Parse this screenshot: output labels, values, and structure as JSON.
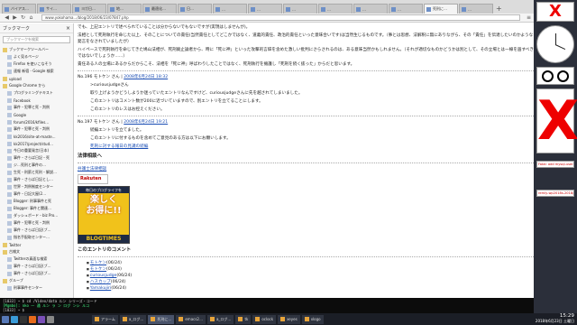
{
  "browser": {
    "window_title": "死刑に関する報日の見解 - 死刑廃止のつぶやき - Mozilla Firefox",
    "tabs": [
      "バイアス…",
      "サイ…",
      "ヨガ日…",
      "地…",
      "最適化…",
      "日…",
      "…",
      "…",
      "…",
      "…",
      "…",
      "…",
      "死刑に…",
      "…"
    ],
    "active_tab": 12,
    "url": "www.yokohama.../blog/2018/06/23/07847.php",
    "nav": {
      "back": "◀",
      "forward": "▶",
      "reload": "↻",
      "home": "⌂"
    }
  },
  "sidebar": {
    "title": "ブックマーク",
    "close": "×",
    "search_placeholder": "ブックマークを検索",
    "items": [
      {
        "label": "ブックマークツールバー",
        "folder": true
      },
      {
        "label": "よく見るページ",
        "folder": false
      },
      {
        "label": "Firefox を使いこなそう",
        "folder": false
      },
      {
        "label": "速報 新宿 - Google 検索",
        "folder": false
      },
      {
        "label": "upload",
        "folder": true
      },
      {
        "label": "Google Chrome から",
        "folder": true
      },
      {
        "label": "プログラミングテキスト",
        "folder": false
      },
      {
        "label": "Facebook",
        "folder": false
      },
      {
        "label": "事件・犯罪と死・判例",
        "folder": false
      },
      {
        "label": "Google",
        "folder": false
      },
      {
        "label": "forum/2016/kfiles...",
        "folder": false
      },
      {
        "label": "事件・犯罪と死・判例",
        "folder": false
      },
      {
        "label": "kk2016/site-at-maste...",
        "folder": false
      },
      {
        "label": "kk2017/project/stud...",
        "folder": false
      },
      {
        "label": "今日の重要発言(日本)",
        "folder": false
      },
      {
        "label": "事件・さらば日記・死",
        "folder": false
      },
      {
        "label": "ジ…死刑と事件の…",
        "folder": false
      },
      {
        "label": "生死・刑罰と死刑・解説…",
        "folder": false
      },
      {
        "label": "事件・さらば日記とし…",
        "folder": false
      },
      {
        "label": "世界・判例制度センター",
        "folder": false
      },
      {
        "label": "事件・日記大屋(2…",
        "folder": false
      },
      {
        "label": "Blogger: 刑事事件と死",
        "folder": false
      },
      {
        "label": "Blogger: 事件と関連…",
        "folder": false
      },
      {
        "label": "ダッシュボード・biz Pro...",
        "folder": false
      },
      {
        "label": "事件・犯罪と死・判例",
        "folder": false
      },
      {
        "label": "事件・さらば日記(ブ…",
        "folder": false
      },
      {
        "label": "指名手配取センター…",
        "folder": false
      },
      {
        "label": "Twitter",
        "folder": true
      },
      {
        "label": "古雑文",
        "folder": true
      },
      {
        "label": "Twitterの真面な検索",
        "folder": false
      },
      {
        "label": "事件・さらば日記(ブ…",
        "folder": false
      },
      {
        "label": "事件・さらば日記(ブ…",
        "folder": false
      },
      {
        "label": "グループ",
        "folder": true
      },
      {
        "label": "刑事事件センター",
        "folder": false
      }
    ]
  },
  "content": {
    "para1": "でも、上記エントリで述べられていることは分からないでもないですが(実現はしませんが)。",
    "para2": "法相として死刑執行を命じた以上、そのことについての責任(当然責任としてどこかではなく、道義的責任、政治的責任といった意味合いです)は当然生じるものです。（事とは思想、法解釈に無にありながら、その「責任」を伝達したいのかような発言をなされていましたが）",
    "para3": "ハイペースで死刑執行を命じてきた鳩山法相が、死刑廃止論者から、時に「死に神」といった攻撃的言辞を含めた激しい批判にさらされるのは、ある意味当然かもしれません。（それが適切なものかどうかは別として、その立場とは一線を画すべきではないでしょうか……）",
    "para4": "責任ある人の立場にあるからだからこそ、法相を「死に神」呼ばわりしたことではなく、死刑執行を擁護し「死刑を続く抜った」からだと思います。",
    "comment1_meta": "No.196 モトケン さん",
    "comment1_date": "2008年6月24日 18:32",
    "comment1_lines": [
      ">curiousjudgeさん",
      "取り上げようかどうしようか迷っていたエントリなんですけど、curiousjudgeさんに先を越されてしまいました。",
      "このエントリはコメント数が200に近づいていますので、別エントリを立てることにします。",
      "このエントリのレスはお控えください。"
    ],
    "comment2_meta": "No.197 モトケン さん",
    "comment2_date": "2008年6月24日 19:21",
    "comment2_lines": [
      "続編エントリを立てました。",
      "このエントリに付するものを含めてご意見のある方は以下にお願いします。"
    ],
    "comment2_link": "死刑に対する報日の見識の続編",
    "law_heading": "法律相談へ",
    "law_link": "弁護士法律相談",
    "rakuten": "Rakuten",
    "banner_top": "毎日のブログライフを",
    "banner_mid": "楽しく\nお得に!!",
    "banner_bottom": "BLOGTIMES",
    "comments_heading": "このエントリのコメント",
    "comments": [
      {
        "name": "モトケン",
        "date": "(06/24)"
      },
      {
        "name": "モトケン",
        "date": "(06/24)"
      },
      {
        "name": "curiousjudge",
        "date": "(06/24)"
      },
      {
        "name": "ハスカップ",
        "date": "(06/24)"
      },
      {
        "name": "Yamakujiri",
        "date": "(06/24)"
      }
    ]
  },
  "terminal": {
    "line1": "[1033] ~ $ cd /Video/data ルン シリーズ・コード",
    "line2": "[Mgmbo]:  nko  一 通 ルン ラ ン ログ ンシ ルコ",
    "line3": "[1033] ~ $"
  },
  "right_widgets": {
    "x_mark": "X",
    "note1": "Fatal: add mysql-user-f",
    "note2": "remly-wp2018s-2018/Y"
  },
  "taskbar": {
    "tasks": [
      {
        "label": "アラーム",
        "active": false
      },
      {
        "label": "a_ログ…",
        "active": false
      },
      {
        "label": "死刑に…",
        "active": true
      },
      {
        "label": "emacs2…",
        "active": false
      },
      {
        "label": "a_ログ…",
        "active": false
      },
      {
        "label": "tk",
        "active": false
      },
      {
        "label": "oclock",
        "active": false
      },
      {
        "label": "xeyes",
        "active": false
      },
      {
        "label": "xlogo",
        "active": false
      }
    ],
    "time": "15:29",
    "date": "2018年6月23日 土曜日"
  },
  "colors": {
    "link": "#1a4db3",
    "taskbar": "#1b1e26",
    "desktop": "#2b2f3a",
    "x_red": "#e00000"
  }
}
